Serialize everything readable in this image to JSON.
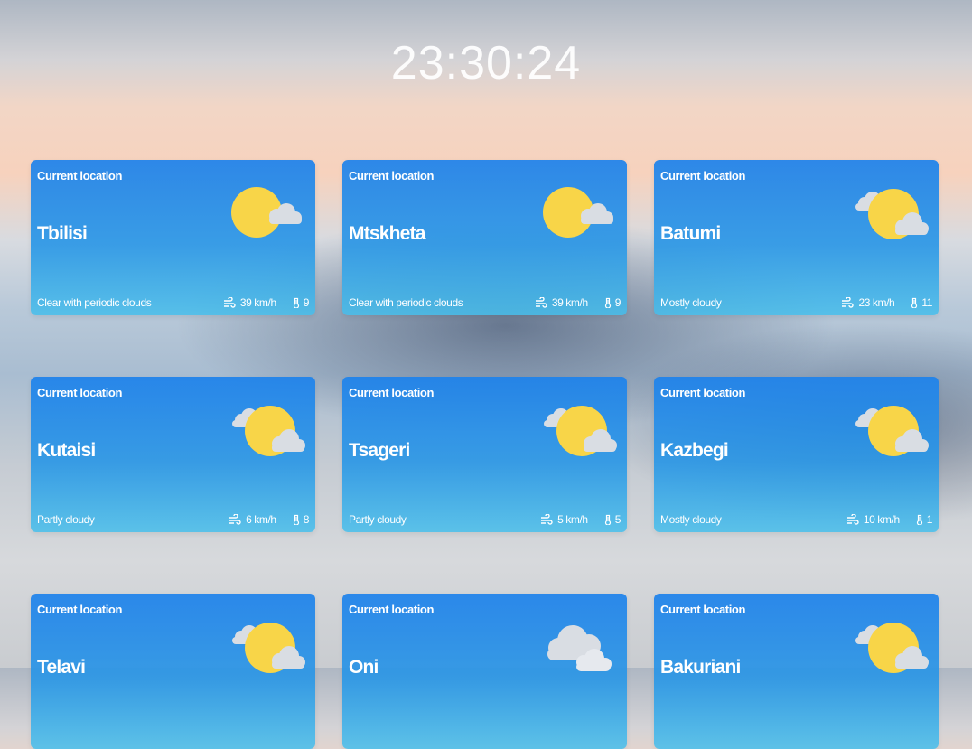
{
  "clock": "23:30:24",
  "cards": [
    {
      "location_label": "Current location",
      "city": "Tbilisi",
      "description": "Clear with periodic clouds",
      "wind": "39 km/h",
      "temp": "9",
      "icon": "sun-small-cloud-icon"
    },
    {
      "location_label": "Current location",
      "city": "Mtskheta",
      "description": "Clear with periodic clouds",
      "wind": "39 km/h",
      "temp": "9",
      "icon": "sun-small-cloud-icon"
    },
    {
      "location_label": "Current location",
      "city": "Batumi",
      "description": "Mostly cloudy",
      "wind": "23 km/h",
      "temp": "11",
      "icon": "sun-behind-clouds-icon"
    },
    {
      "location_label": "Current location",
      "city": "Kutaisi",
      "description": "Partly cloudy",
      "wind": "6 km/h",
      "temp": "8",
      "icon": "sun-behind-clouds-icon"
    },
    {
      "location_label": "Current location",
      "city": "Tsageri",
      "description": "Partly cloudy",
      "wind": "5 km/h",
      "temp": "5",
      "icon": "sun-behind-clouds-icon"
    },
    {
      "location_label": "Current location",
      "city": "Kazbegi",
      "description": "Mostly cloudy",
      "wind": "10 km/h",
      "temp": "1",
      "icon": "sun-behind-clouds-icon"
    },
    {
      "location_label": "Current location",
      "city": "Telavi",
      "description": "",
      "wind": "",
      "temp": "",
      "icon": "sun-behind-clouds-icon"
    },
    {
      "location_label": "Current location",
      "city": "Oni",
      "description": "",
      "wind": "",
      "temp": "",
      "icon": "clouds-icon"
    },
    {
      "location_label": "Current location",
      "city": "Bakuriani",
      "description": "",
      "wind": "",
      "temp": "",
      "icon": "sun-behind-clouds-icon"
    }
  ],
  "colors": {
    "card_top": "#1e82eb",
    "card_bottom": "#46bee b",
    "sun": "#f8d548",
    "cloud": "#d9dde3"
  }
}
